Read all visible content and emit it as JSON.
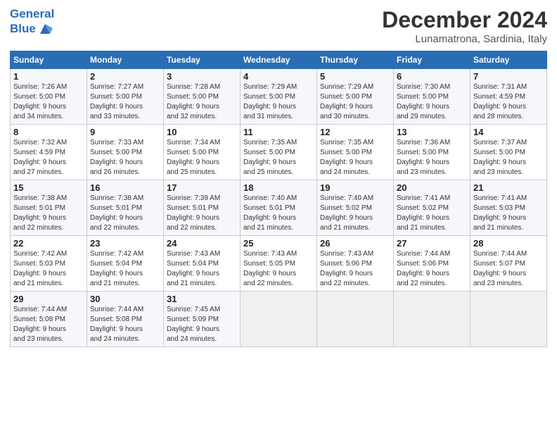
{
  "logo": {
    "line1": "General",
    "line2": "Blue"
  },
  "title": "December 2024",
  "subtitle": "Lunamatrona, Sardinia, Italy",
  "weekdays": [
    "Sunday",
    "Monday",
    "Tuesday",
    "Wednesday",
    "Thursday",
    "Friday",
    "Saturday"
  ],
  "weeks": [
    [
      {
        "day": "1",
        "detail": "Sunrise: 7:26 AM\nSunset: 5:00 PM\nDaylight: 9 hours\nand 34 minutes."
      },
      {
        "day": "2",
        "detail": "Sunrise: 7:27 AM\nSunset: 5:00 PM\nDaylight: 9 hours\nand 33 minutes."
      },
      {
        "day": "3",
        "detail": "Sunrise: 7:28 AM\nSunset: 5:00 PM\nDaylight: 9 hours\nand 32 minutes."
      },
      {
        "day": "4",
        "detail": "Sunrise: 7:29 AM\nSunset: 5:00 PM\nDaylight: 9 hours\nand 31 minutes."
      },
      {
        "day": "5",
        "detail": "Sunrise: 7:29 AM\nSunset: 5:00 PM\nDaylight: 9 hours\nand 30 minutes."
      },
      {
        "day": "6",
        "detail": "Sunrise: 7:30 AM\nSunset: 5:00 PM\nDaylight: 9 hours\nand 29 minutes."
      },
      {
        "day": "7",
        "detail": "Sunrise: 7:31 AM\nSunset: 4:59 PM\nDaylight: 9 hours\nand 28 minutes."
      }
    ],
    [
      {
        "day": "8",
        "detail": "Sunrise: 7:32 AM\nSunset: 4:59 PM\nDaylight: 9 hours\nand 27 minutes."
      },
      {
        "day": "9",
        "detail": "Sunrise: 7:33 AM\nSunset: 5:00 PM\nDaylight: 9 hours\nand 26 minutes."
      },
      {
        "day": "10",
        "detail": "Sunrise: 7:34 AM\nSunset: 5:00 PM\nDaylight: 9 hours\nand 25 minutes."
      },
      {
        "day": "11",
        "detail": "Sunrise: 7:35 AM\nSunset: 5:00 PM\nDaylight: 9 hours\nand 25 minutes."
      },
      {
        "day": "12",
        "detail": "Sunrise: 7:35 AM\nSunset: 5:00 PM\nDaylight: 9 hours\nand 24 minutes."
      },
      {
        "day": "13",
        "detail": "Sunrise: 7:36 AM\nSunset: 5:00 PM\nDaylight: 9 hours\nand 23 minutes."
      },
      {
        "day": "14",
        "detail": "Sunrise: 7:37 AM\nSunset: 5:00 PM\nDaylight: 9 hours\nand 23 minutes."
      }
    ],
    [
      {
        "day": "15",
        "detail": "Sunrise: 7:38 AM\nSunset: 5:01 PM\nDaylight: 9 hours\nand 22 minutes."
      },
      {
        "day": "16",
        "detail": "Sunrise: 7:38 AM\nSunset: 5:01 PM\nDaylight: 9 hours\nand 22 minutes."
      },
      {
        "day": "17",
        "detail": "Sunrise: 7:39 AM\nSunset: 5:01 PM\nDaylight: 9 hours\nand 22 minutes."
      },
      {
        "day": "18",
        "detail": "Sunrise: 7:40 AM\nSunset: 5:01 PM\nDaylight: 9 hours\nand 21 minutes."
      },
      {
        "day": "19",
        "detail": "Sunrise: 7:40 AM\nSunset: 5:02 PM\nDaylight: 9 hours\nand 21 minutes."
      },
      {
        "day": "20",
        "detail": "Sunrise: 7:41 AM\nSunset: 5:02 PM\nDaylight: 9 hours\nand 21 minutes."
      },
      {
        "day": "21",
        "detail": "Sunrise: 7:41 AM\nSunset: 5:03 PM\nDaylight: 9 hours\nand 21 minutes."
      }
    ],
    [
      {
        "day": "22",
        "detail": "Sunrise: 7:42 AM\nSunset: 5:03 PM\nDaylight: 9 hours\nand 21 minutes."
      },
      {
        "day": "23",
        "detail": "Sunrise: 7:42 AM\nSunset: 5:04 PM\nDaylight: 9 hours\nand 21 minutes."
      },
      {
        "day": "24",
        "detail": "Sunrise: 7:43 AM\nSunset: 5:04 PM\nDaylight: 9 hours\nand 21 minutes."
      },
      {
        "day": "25",
        "detail": "Sunrise: 7:43 AM\nSunset: 5:05 PM\nDaylight: 9 hours\nand 22 minutes."
      },
      {
        "day": "26",
        "detail": "Sunrise: 7:43 AM\nSunset: 5:06 PM\nDaylight: 9 hours\nand 22 minutes."
      },
      {
        "day": "27",
        "detail": "Sunrise: 7:44 AM\nSunset: 5:06 PM\nDaylight: 9 hours\nand 22 minutes."
      },
      {
        "day": "28",
        "detail": "Sunrise: 7:44 AM\nSunset: 5:07 PM\nDaylight: 9 hours\nand 23 minutes."
      }
    ],
    [
      {
        "day": "29",
        "detail": "Sunrise: 7:44 AM\nSunset: 5:08 PM\nDaylight: 9 hours\nand 23 minutes."
      },
      {
        "day": "30",
        "detail": "Sunrise: 7:44 AM\nSunset: 5:08 PM\nDaylight: 9 hours\nand 24 minutes."
      },
      {
        "day": "31",
        "detail": "Sunrise: 7:45 AM\nSunset: 5:09 PM\nDaylight: 9 hours\nand 24 minutes."
      },
      {
        "day": "",
        "detail": ""
      },
      {
        "day": "",
        "detail": ""
      },
      {
        "day": "",
        "detail": ""
      },
      {
        "day": "",
        "detail": ""
      }
    ]
  ]
}
